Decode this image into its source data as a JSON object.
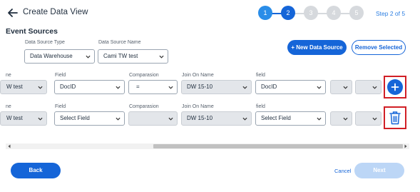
{
  "header": {
    "title": "Create Data View",
    "step_label": "Step 2 of 5"
  },
  "stepper": {
    "steps": [
      "1",
      "2",
      "3",
      "4",
      "5"
    ],
    "current": 2,
    "colors": {
      "done": "#2a8de8",
      "current": "#1565d8",
      "todo": "#d6d9dd"
    }
  },
  "section": {
    "title": "Event Sources"
  },
  "source": {
    "type_label": "Data Source Type",
    "type_value": "Data Warehouse",
    "name_label": "Data Source Name",
    "name_value": "Cami TW test"
  },
  "actions": {
    "new_data_source": "+ New Data Source",
    "remove_selected": "Remove Selected"
  },
  "rows": [
    {
      "col0_label": "ne",
      "col0_value": "W test",
      "field_label": "Field",
      "field_value": "DocID",
      "comparison_label": "Comparasion",
      "comparison_value": "=",
      "join_label": "Join On Name",
      "join_value": "DW 15-10",
      "field2_label": "field",
      "field2_value": "DocID",
      "action_icon": "plus-icon"
    },
    {
      "col0_label": "ne",
      "col0_value": "W test",
      "field_label": "Field",
      "field_value": "Select Field",
      "comparison_label": "Comparasion",
      "comparison_value": "",
      "join_label": "Join On Name",
      "join_value": "DW 15-10",
      "field2_label": "field",
      "field2_value": "Select Field",
      "action_icon": "trash-icon"
    }
  ],
  "footer": {
    "back": "Back",
    "cancel": "Cancel",
    "next": "Next"
  },
  "colors": {
    "primary": "#1565d8",
    "highlight": "#d11f26"
  }
}
